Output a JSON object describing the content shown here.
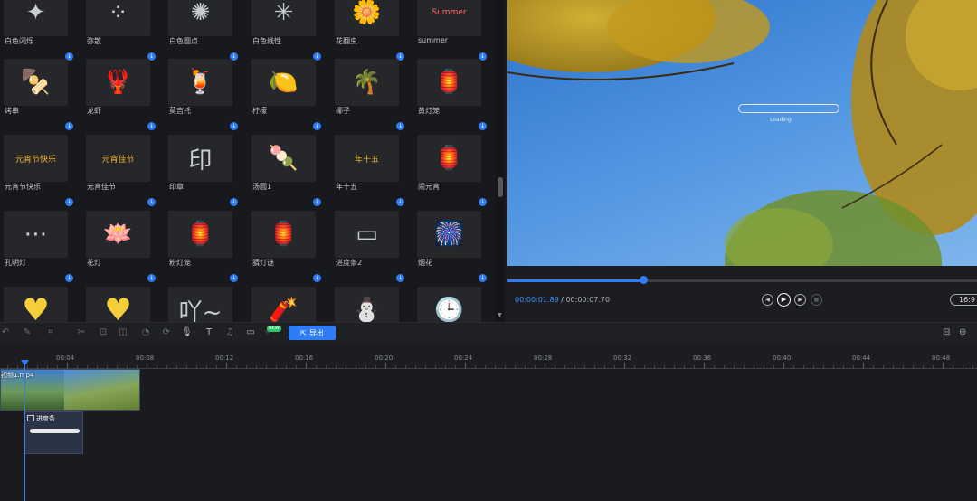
{
  "library": {
    "rows": [
      [
        {
          "label": "白色闪烁",
          "icon": "sparkle-icon",
          "glyph": "✦"
        },
        {
          "label": "弥散",
          "icon": "dots-icon",
          "glyph": "⁘"
        },
        {
          "label": "白色圆点",
          "icon": "burst-icon",
          "glyph": "✺"
        },
        {
          "label": "白色线性",
          "icon": "rays-icon",
          "glyph": "✳"
        },
        {
          "label": "花翻虫",
          "icon": "flower-icon",
          "glyph": "🌼"
        },
        {
          "label": "summer",
          "icon": "summer-badge-icon",
          "glyph": "Summer"
        }
      ],
      [
        {
          "label": "烤串",
          "icon": "skewer-icon",
          "glyph": "🍢"
        },
        {
          "label": "龙虾",
          "icon": "lobster-icon",
          "glyph": "🦞"
        },
        {
          "label": "莫吉托",
          "icon": "cocktail-icon",
          "glyph": "🍹"
        },
        {
          "label": "柠檬",
          "icon": "lemon-icon",
          "glyph": "🍋"
        },
        {
          "label": "椰子",
          "icon": "palm-icon",
          "glyph": "🌴"
        },
        {
          "label": "黄灯笼",
          "icon": "yellow-lantern-icon",
          "glyph": "🏮"
        }
      ],
      [
        {
          "label": "元宵节快乐",
          "icon": "banner-icon",
          "glyph": "元宵节快乐"
        },
        {
          "label": "元宵佳节",
          "icon": "festival-text-icon",
          "glyph": "元宵佳节"
        },
        {
          "label": "印章",
          "icon": "seal-icon",
          "glyph": "印"
        },
        {
          "label": "汤圆1",
          "icon": "tangyuan-icon",
          "glyph": "🍡"
        },
        {
          "label": "年十五",
          "icon": "fifteen-text-icon",
          "glyph": "年十五"
        },
        {
          "label": "闹元宵",
          "icon": "red-lantern-icon",
          "glyph": "🏮"
        }
      ],
      [
        {
          "label": "孔明灯",
          "icon": "sky-lantern-icon",
          "glyph": "⋯"
        },
        {
          "label": "花灯",
          "icon": "lotus-icon",
          "glyph": "🪷"
        },
        {
          "label": "粉灯笼",
          "icon": "pink-lantern-icon",
          "glyph": "🏮"
        },
        {
          "label": "猜灯谜",
          "icon": "riddle-lantern-icon",
          "glyph": "🏮"
        },
        {
          "label": "进度条2",
          "icon": "progress-bar-icon",
          "glyph": "▭"
        },
        {
          "label": "烟花",
          "icon": "fireworks-icon",
          "glyph": "🎆"
        }
      ],
      [
        {
          "label": "",
          "icon": "yellow-heart-icon",
          "glyph": "♥"
        },
        {
          "label": "",
          "icon": "heart-outline-icon",
          "glyph": "♥"
        },
        {
          "label": "",
          "icon": "speech-icon",
          "glyph": "吖~"
        },
        {
          "label": "",
          "icon": "firecracker-icon",
          "glyph": "🧨"
        },
        {
          "label": "",
          "icon": "snowman-icon",
          "glyph": "⛄"
        },
        {
          "label": "",
          "icon": "clock-icon",
          "glyph": "🕒"
        }
      ]
    ]
  },
  "preview": {
    "overlay_text": "Loading",
    "progress_fraction": 0.289,
    "time_current": "00:00:01.89",
    "time_separator": " / ",
    "time_total": "00:00:07.70",
    "ratio": "16:9"
  },
  "toolbar": {
    "new_badge": "NEW",
    "export_label": "导出"
  },
  "timeline": {
    "ticks": [
      "00:04",
      "00:08",
      "00:12",
      "00:16",
      "00:20",
      "00:24",
      "00:28",
      "00:32",
      "00:36",
      "00:40",
      "00:44",
      "00:48"
    ],
    "video_clip_label": "视频1.mp4",
    "effect_clip_label": "进度条"
  },
  "colors": {
    "accent": "#2f7df6",
    "new_badge": "#2cc36b"
  }
}
